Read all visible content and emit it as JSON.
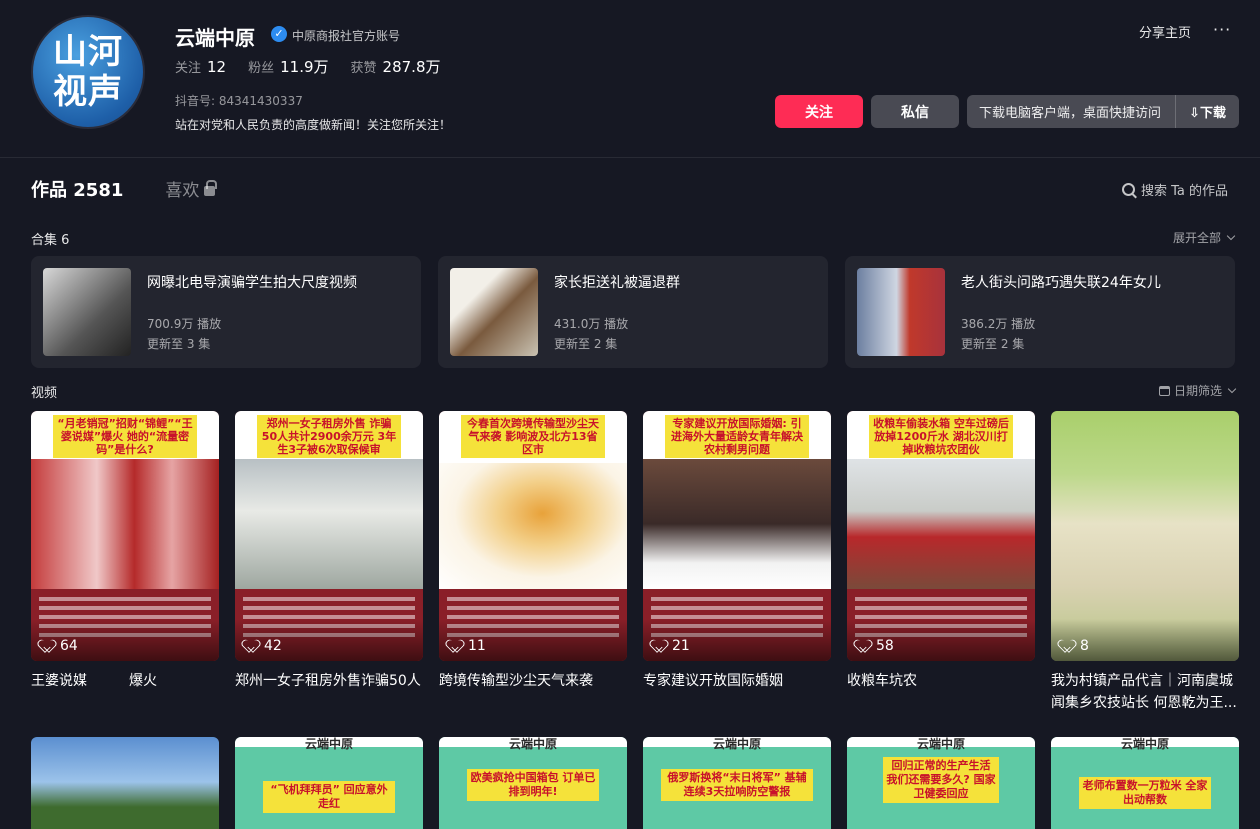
{
  "profile": {
    "avatar_text": "山河视声",
    "name": "云端中原",
    "verified_label": "中原商报社官方账号",
    "stats": [
      {
        "label": "关注",
        "value": "12"
      },
      {
        "label": "粉丝",
        "value": "11.9万"
      },
      {
        "label": "获赞",
        "value": "287.8万"
      }
    ],
    "douyin_id": "抖音号: 84341430337",
    "bio": "站在对党和人民负责的高度做新闻！关注您所关注！"
  },
  "actions": {
    "share": "分享主页",
    "more": "···",
    "follow": "关注",
    "message": "私信",
    "download_text": "下载电脑客户端，桌面快捷访问",
    "download_btn": "⇩下载"
  },
  "tabs": {
    "works_label": "作品",
    "works_count": "2581",
    "likes_label": "喜欢",
    "search_label": "搜索 Ta 的作品"
  },
  "collections": {
    "title": "合集 6",
    "expand": "展开全部",
    "items": [
      {
        "title": "网曝北电导演骗学生拍大尺度视频",
        "plays": "700.9万 播放",
        "update": "更新至 3 集"
      },
      {
        "title": "家长拒送礼被逼退群",
        "plays": "431.0万 播放",
        "update": "更新至 2 集"
      },
      {
        "title": "老人街头问路巧遇失联24年女儿",
        "plays": "386.2万 播放",
        "update": "更新至 2 集"
      }
    ]
  },
  "videos": {
    "title": "视频",
    "filter": "日期筛选",
    "items": [
      {
        "caption": "“月老销冠”招财“锦鲤”“王婆说媒”爆火 她的“流量密码”是什么?",
        "likes": "64",
        "title": "王婆说媒　　　爆火"
      },
      {
        "caption": "郑州一女子租房外售 诈骗50人共计2900余万元 3年生3子被6次取保候审",
        "likes": "42",
        "title": "郑州一女子租房外售诈骗50人"
      },
      {
        "caption": "今春首次跨境传输型沙尘天气来袭 影响波及北方13省区市",
        "likes": "11",
        "title": "跨境传输型沙尘天气来袭"
      },
      {
        "caption": "专家建议开放国际婚姻: 引进海外大量适龄女青年解决农村剩男问题",
        "likes": "21",
        "title": "专家建议开放国际婚姻"
      },
      {
        "caption": "收粮车偷装水箱 空车过磅后放掉1200斤水 湖北汉川打掉收粮坑农团伙",
        "likes": "58",
        "title": "收粮车坑农"
      },
      {
        "caption": "",
        "likes": "8",
        "title": "我为村镇产品代言｜河南虞城闻集乡农技站长 何恩乾为王..."
      }
    ]
  },
  "row2": {
    "brand": "云端中原",
    "items": [
      {
        "caption": ""
      },
      {
        "caption": "“飞机拜拜员” 回应意外走红"
      },
      {
        "caption": "欧美疯抢中国箱包 订单已排到明年!"
      },
      {
        "caption": "俄罗斯换将“末日将军” 基辅连续3天拉响防空警报"
      },
      {
        "caption": "回归正常的生产生活 我们还需要多久? 国家卫健委回应"
      },
      {
        "caption": "老师布置数一万粒米 全家出动帮数"
      }
    ]
  },
  "colors": {
    "accent": "#fe2c55",
    "background": "#161823",
    "verify": "#2d8cf0"
  }
}
